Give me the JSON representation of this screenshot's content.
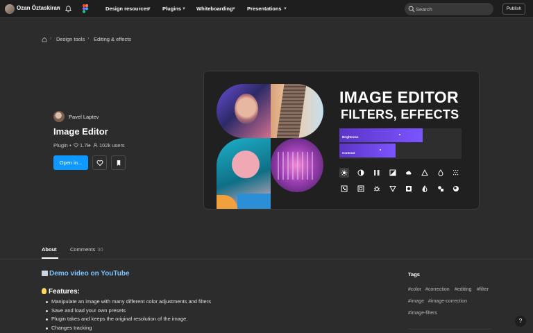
{
  "topbar": {
    "user_name": "Ozan Öztaskiran",
    "nav": [
      "Design resources",
      "Plugins",
      "Whiteboarding",
      "Presentations"
    ],
    "search_placeholder": "Search",
    "publish_label": "Publish"
  },
  "breadcrumb": [
    "Design tools",
    "Editing & effects"
  ],
  "plugin": {
    "author": "Pavel Laptev",
    "title": "Image Editor",
    "type": "Plugin",
    "likes": "1.7k",
    "users": "102k users",
    "open_label": "Open in..."
  },
  "cover": {
    "title_line1": "IMAGE EDITOR",
    "title_line2": "FILTERS, EFFECTS",
    "sliders": [
      {
        "label": "Brightness",
        "value": 0.68
      },
      {
        "label": "Contrast",
        "value": 0.46
      }
    ],
    "accent": "#6a44ef"
  },
  "tabs": {
    "about": "About",
    "comments": "Comments",
    "comments_count": "30"
  },
  "description": {
    "demo_link": "Demo video on YouTube",
    "features_heading": "Features:",
    "features": [
      "Manipulate an image with many different color adjustments and filters",
      "Save and load your own presets",
      "Plugin takes and keeps the original resolution of the image.",
      "Changes tracking"
    ]
  },
  "tags": {
    "heading": "Tags",
    "items": [
      "#color",
      "#correction",
      "#editing",
      "#filter",
      "#image",
      "#image-correction",
      "#image-filters"
    ]
  },
  "help_label": "?",
  "colors": {
    "topbar_bg": "#1e1e1e",
    "page_bg": "#2c2c2c",
    "primary_button": "#0d99ff",
    "link": "#7cc4ff"
  }
}
